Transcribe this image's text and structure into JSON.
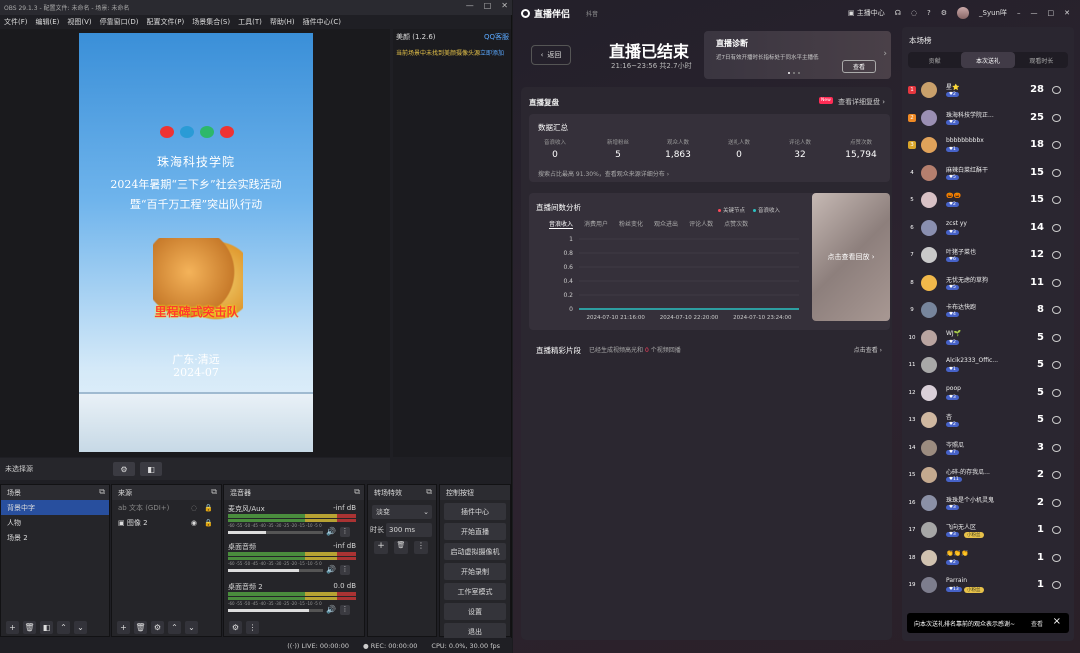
{
  "obs": {
    "title": "OBS 29.1.3 - 配置文件: 未命名 - 场景: 未命名",
    "menu": [
      "文件(F)",
      "编辑(E)",
      "视图(V)",
      "停靠窗口(D)",
      "配置文件(P)",
      "场景集合(S)",
      "工具(T)",
      "帮助(H)",
      "插件中心(C)"
    ],
    "window_buttons": [
      "—",
      "□",
      "✕"
    ],
    "poster": {
      "school": "珠海科技学院",
      "line2": "2024年暑期“三下乡”社会实践活动",
      "line3": "暨“百千万工程”突出队行动",
      "slogan": "里程碑式突击队",
      "place": "广东·清远",
      "date": "2024-07"
    },
    "beauty": {
      "title": "美颜 (1.2.6)",
      "qq": "QQ客服",
      "warning": "当前场景中未找到美颜摄像头源",
      "link": "立即添加"
    },
    "source_bar_label": "未选择源",
    "scenes": {
      "title": "场景",
      "items": [
        "背景中字",
        "人物",
        "场景 2"
      ],
      "selected": 0
    },
    "sources": {
      "title": "来源",
      "items": [
        {
          "name": "文本 (GDI+)"
        },
        {
          "name": "图像 2"
        }
      ]
    },
    "mixer": {
      "title": "混音器",
      "scale": "-60 -55 -50 -45 -40 -35 -30 -25 -20 -15 -10 -5 0",
      "channels": [
        {
          "name": "麦克风/Aux",
          "db": "-inf dB",
          "level": 0.4
        },
        {
          "name": "桌面音频",
          "db": "-inf dB",
          "level": 0.75
        },
        {
          "name": "桌面音频 2",
          "db": "0.0 dB",
          "level": 0.85
        }
      ]
    },
    "transitions": {
      "title": "转场特效",
      "type": "淡变",
      "duration_label": "时长",
      "duration": "300 ms"
    },
    "controls": {
      "title": "控制按钮",
      "buttons": [
        "插件中心",
        "开始直播",
        "启动虚拟摄像机",
        "开始录制",
        "工作室模式",
        "设置",
        "退出"
      ]
    },
    "status": {
      "live": "LIVE: 00:00:00",
      "rec": "REC: 00:00:00",
      "cpu": "CPU: 0.0%, 30.00 fps"
    }
  },
  "dy": {
    "app": "直播伴侣",
    "sub": "抖音",
    "right": [
      "主播中心",
      "_Syun咩"
    ],
    "back": "返回",
    "ended": "直播已结束",
    "time": "21:16~23:56 共2.7小时",
    "diag": {
      "title": "直播诊断",
      "desc": "近7日有效开播时长指标处于同水平主播低",
      "btn": "查看"
    },
    "panel_title": "直播复盘",
    "new_tag": "New",
    "more": "查看详细复盘 ›",
    "summary": {
      "title": "数据汇总",
      "stats": [
        {
          "k": "音浪收入",
          "v": "0"
        },
        {
          "k": "新增粉丝",
          "v": "5"
        },
        {
          "k": "观众人数",
          "v": "1,863"
        },
        {
          "k": "送礼人数",
          "v": "0"
        },
        {
          "k": "评论人数",
          "v": "32"
        },
        {
          "k": "点赞次数",
          "v": "15,794"
        }
      ],
      "foot": "搜索占比最高 91.30%，查看观众来源详细分布 ›"
    },
    "analysis": {
      "title": "直播间数分析",
      "legend": [
        "关键节点",
        "音浪收入"
      ],
      "tabs": [
        "音浪收入",
        "消费用户",
        "粉丝变化",
        "观众进出",
        "评论人数",
        "点赞次数"
      ],
      "thumb_label": "点击查看回放 ›"
    },
    "clips": {
      "title": "直播精彩片段",
      "desc_pre": "已经生成视频高光和",
      "count": "0",
      "desc_post": "个视频回播",
      "link": "点击查看 ›"
    },
    "rank": {
      "title": "本场榜",
      "tabs": [
        "贡献",
        "本次送礼",
        "观看时长"
      ],
      "tab_selected": 1,
      "rows": [
        {
          "n": "1",
          "name": "星⭐",
          "lv": "♥2",
          "ct": "28",
          "badge": ""
        },
        {
          "n": "2",
          "name": "珠海科技学院正...",
          "lv": "♥2",
          "ct": "25",
          "badge": ""
        },
        {
          "n": "3",
          "name": "bbbbbbbbbx",
          "lv": "♥1",
          "ct": "18",
          "badge": ""
        },
        {
          "n": "4",
          "name": "麻辣白菜红酥干",
          "lv": "♥5",
          "ct": "15",
          "badge": ""
        },
        {
          "n": "5",
          "name": "🎃🎃",
          "lv": "♥2",
          "ct": "15",
          "badge": ""
        },
        {
          "n": "6",
          "name": "zcst yy",
          "lv": "♥3",
          "ct": "14",
          "badge": ""
        },
        {
          "n": "7",
          "name": "叶猪子菜也",
          "lv": "♥6",
          "ct": "12",
          "badge": ""
        },
        {
          "n": "8",
          "name": "无忧无虑的草狗",
          "lv": "♥5",
          "ct": "11",
          "badge": ""
        },
        {
          "n": "9",
          "name": "卡布达快跑",
          "lv": "♥4",
          "ct": "8",
          "badge": ""
        },
        {
          "n": "10",
          "name": "WJ🌱",
          "lv": "♥2",
          "ct": "5",
          "badge": ""
        },
        {
          "n": "11",
          "name": "Alcik2333_Offic...",
          "lv": "♥1",
          "ct": "5",
          "badge": ""
        },
        {
          "n": "12",
          "name": "poop",
          "lv": "♥3",
          "ct": "5",
          "badge": ""
        },
        {
          "n": "13",
          "name": "杏",
          "lv": "♥2",
          "ct": "5",
          "badge": ""
        },
        {
          "n": "14",
          "name": "岑照瓜",
          "lv": "♥7",
          "ct": "3",
          "badge": ""
        },
        {
          "n": "15",
          "name": "心碎-的存我瓜...",
          "lv": "♥11",
          "ct": "2",
          "badge": ""
        },
        {
          "n": "16",
          "name": "珠珠是个小机灵鬼",
          "lv": "♥3",
          "ct": "2",
          "badge": ""
        },
        {
          "n": "17",
          "name": "飞向无人区",
          "lv": "♥3",
          "ct": "1",
          "badge": "小粉丝"
        },
        {
          "n": "18",
          "name": "👏👏👏",
          "lv": "♥2",
          "ct": "1",
          "badge": ""
        },
        {
          "n": "19",
          "name": "Parrain",
          "lv": "♥13",
          "ct": "1",
          "badge": "小粉丝"
        }
      ],
      "toast": "向本次送礼排名靠前的观众表示感谢~",
      "toast_btn": "查看"
    }
  },
  "chart_data": {
    "type": "line",
    "x": [
      "2024-07-10 21:16:00",
      "2024-07-10 22:20:00",
      "2024-07-10 23:24:00"
    ],
    "y_ticks": [
      "1",
      "0.8",
      "0.6",
      "0.4",
      "0.2",
      "0"
    ],
    "ylim": [
      0,
      1
    ],
    "series": [
      {
        "name": "音浪收入",
        "values": [
          0,
          0,
          0
        ]
      }
    ]
  }
}
